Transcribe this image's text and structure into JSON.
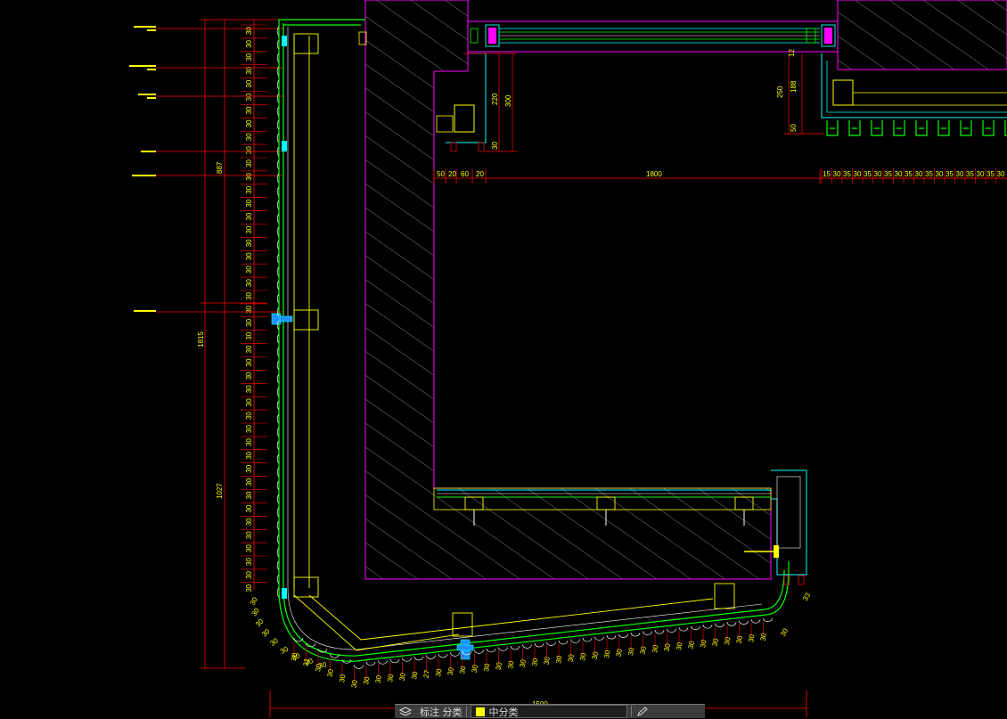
{
  "drawing": {
    "dimensions_left": [
      "887",
      "1815",
      "1027"
    ],
    "dimensions_top": [
      "50",
      "20",
      "60",
      "20",
      "1800"
    ],
    "dimensions_right_stack": [
      "12",
      "188",
      "250",
      "50"
    ],
    "dimensions_mid": [
      "220",
      "300",
      "30"
    ],
    "bottom_total": "1500",
    "repeat_dim": "30",
    "right_row": [
      "15",
      "30",
      "35",
      "30",
      "35",
      "30",
      "35",
      "30",
      "35",
      "30",
      "35",
      "30",
      "35",
      "30",
      "35",
      "30",
      "35",
      "30"
    ],
    "bottom_row": [
      "30",
      "31",
      "30",
      "30",
      "30",
      "30",
      "30",
      "30",
      "30",
      "30",
      "30",
      "27",
      "30",
      "30",
      "30",
      "30",
      "30",
      "30",
      "30",
      "30",
      "30",
      "30",
      "30",
      "30",
      "30",
      "30",
      "30",
      "30",
      "30",
      "30",
      "30",
      "30",
      "30",
      "30",
      "30",
      "30",
      "30",
      "30",
      "30",
      "30",
      "33"
    ],
    "labels_left": [
      "",
      "",
      "",
      "",
      "",
      ""
    ],
    "colors": {
      "background": "#000000",
      "dimension": "#ff0000",
      "text": "#ffff00",
      "glass": "#00ff00",
      "frame": "#00ffff",
      "wall": "#ff00ff",
      "hatch": "#ffffff",
      "steel": "#ffff00"
    }
  },
  "statusbar": {
    "layer_icon": "layers-icon",
    "layer_label": "标注 分类",
    "current_layer": "中分类",
    "edit_icon": "edit-icon"
  }
}
